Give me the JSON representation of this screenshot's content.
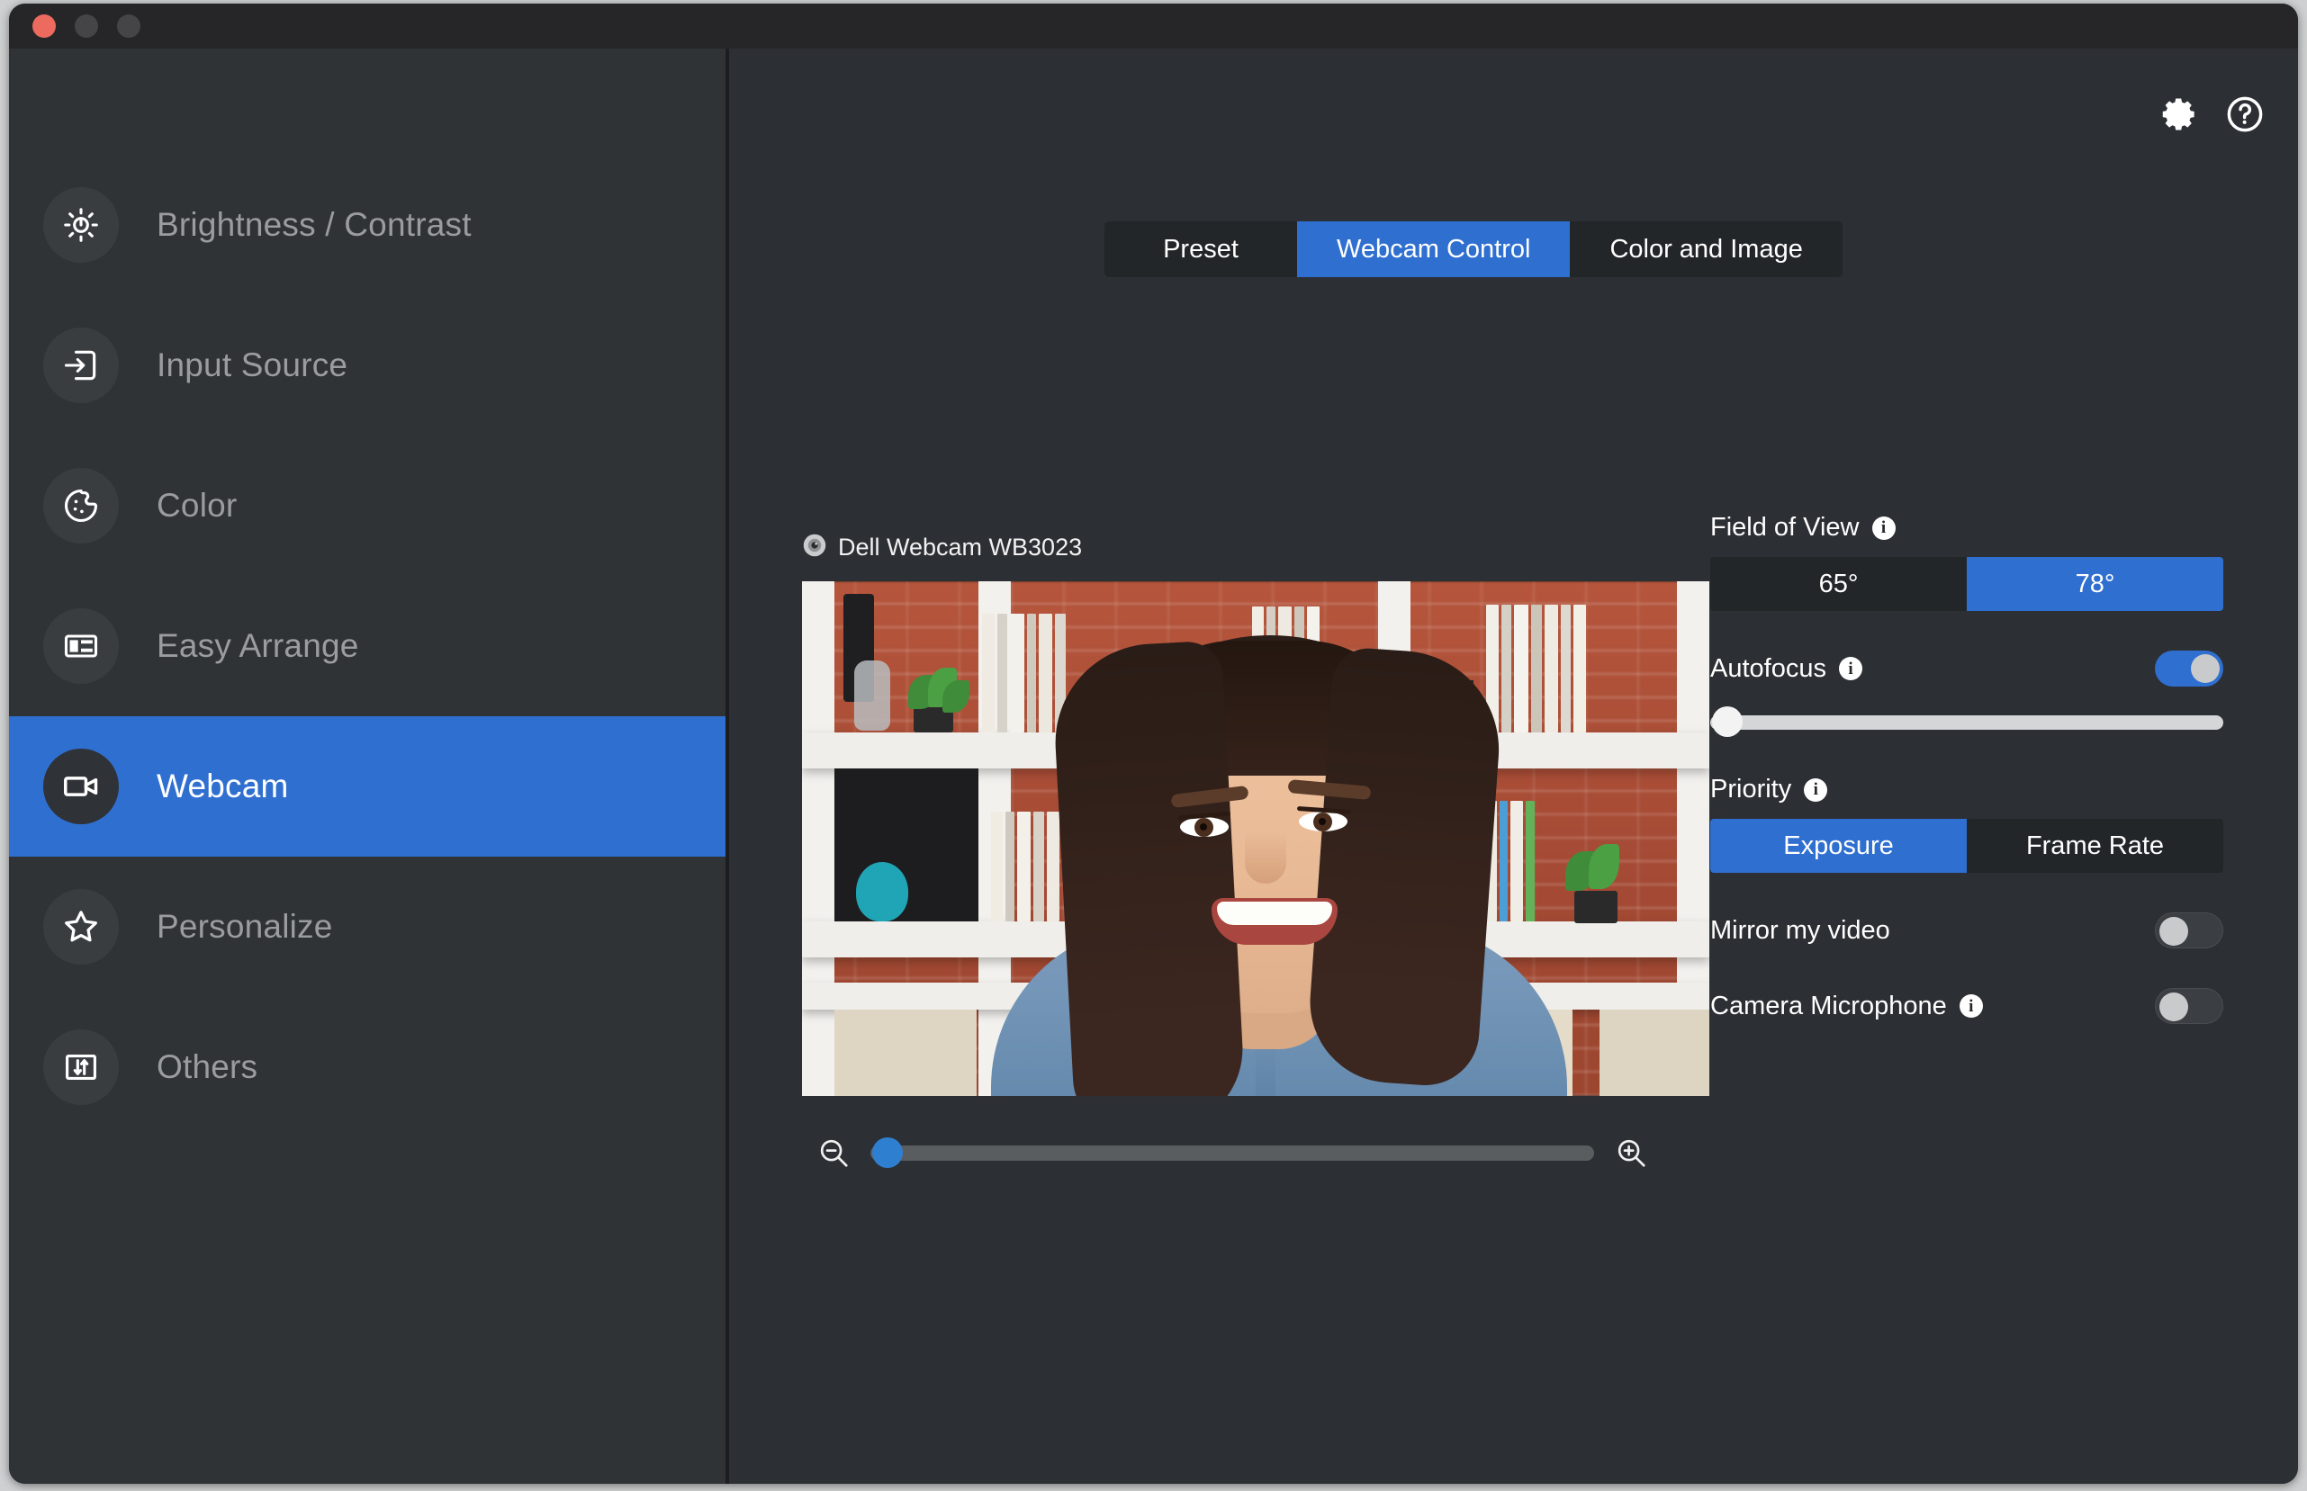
{
  "window": {
    "titlebar": {
      "close_label": "Close",
      "minimize_label": "Minimize",
      "maximize_label": "Maximize"
    }
  },
  "sidebar": {
    "items": [
      {
        "label": "Brightness / Contrast",
        "icon": "brightness-icon",
        "active": false
      },
      {
        "label": "Input Source",
        "icon": "input-source-icon",
        "active": false
      },
      {
        "label": "Color",
        "icon": "color-palette-icon",
        "active": false
      },
      {
        "label": "Easy Arrange",
        "icon": "easy-arrange-icon",
        "active": false
      },
      {
        "label": "Webcam",
        "icon": "webcam-icon",
        "active": true
      },
      {
        "label": "Personalize",
        "icon": "star-icon",
        "active": false
      },
      {
        "label": "Others",
        "icon": "others-icon",
        "active": false
      }
    ]
  },
  "header": {
    "settings_icon": "gear-icon",
    "help_icon": "help-circle-icon"
  },
  "tabs": [
    {
      "label": "Preset",
      "active": false
    },
    {
      "label": "Webcam Control",
      "active": true
    },
    {
      "label": "Color and Image",
      "active": false
    }
  ],
  "preview": {
    "device_icon": "camera-lens-icon",
    "device_name": "Dell Webcam WB3023",
    "zoom": {
      "out_icon": "zoom-out-icon",
      "in_icon": "zoom-in-icon",
      "value_percent": 2
    }
  },
  "controls": {
    "field_of_view": {
      "label": "Field of View",
      "info_icon": "info-icon",
      "options": [
        {
          "label": "65°",
          "selected": false
        },
        {
          "label": "78°",
          "selected": true
        }
      ]
    },
    "autofocus": {
      "label": "Autofocus",
      "info_icon": "info-icon",
      "enabled": true,
      "focus_slider_percent": 0
    },
    "priority": {
      "label": "Priority",
      "info_icon": "info-icon",
      "options": [
        {
          "label": "Exposure",
          "selected": true
        },
        {
          "label": "Frame Rate",
          "selected": false
        }
      ]
    },
    "mirror_my_video": {
      "label": "Mirror my video",
      "enabled": false
    },
    "camera_microphone": {
      "label": "Camera Microphone",
      "info_icon": "info-icon",
      "enabled": false
    }
  },
  "colors": {
    "accent": "#2f6fd0",
    "window_bg": "#2c2f33",
    "sidebar_bg": "#303336",
    "titlebar_bg": "#262628",
    "segment_bg": "#232629",
    "close_dot": "#ec6a5e"
  }
}
